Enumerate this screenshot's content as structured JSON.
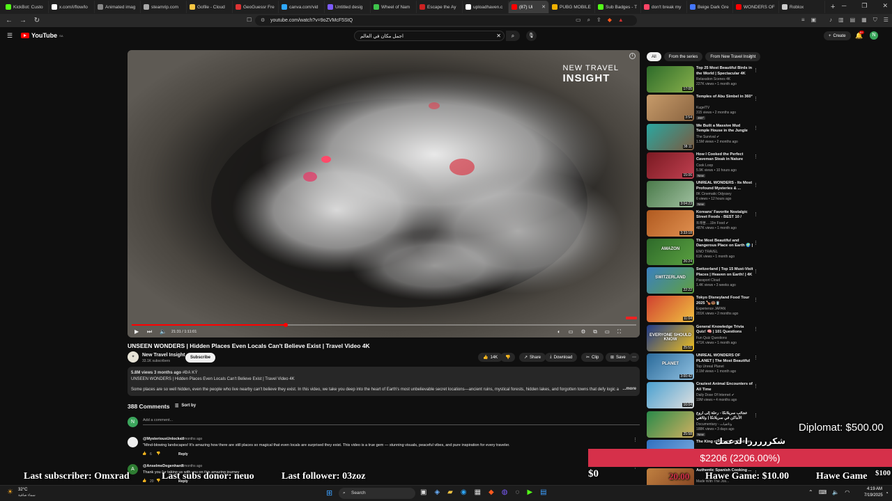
{
  "browser": {
    "tabs": [
      {
        "label": "KickBot: Custo",
        "color": "#53fc18"
      },
      {
        "label": "x.com/i/flow/lo",
        "color": "#ffffff"
      },
      {
        "label": "Animated imag",
        "color": "#888888"
      },
      {
        "label": "steamrip.com",
        "color": "#aaaaaa"
      },
      {
        "label": "Gofile - Cloud",
        "color": "#f5c542"
      },
      {
        "label": "GeoGuessr Fre",
        "color": "#d33"
      },
      {
        "label": "canva.com/vid",
        "color": "#2ea8ff"
      },
      {
        "label": "Untitled desig",
        "color": "#7d5cff"
      },
      {
        "label": "Wheel of Nam",
        "color": "#3ec44b"
      },
      {
        "label": "Escape the Ay",
        "color": "#cc2222"
      },
      {
        "label": "uploadhaven.c",
        "color": "#ffffff"
      },
      {
        "label": "(87) Ui",
        "color": "#ff0000",
        "active": true
      },
      {
        "label": "PUBG MOBILE",
        "color": "#f0b000"
      },
      {
        "label": "Sub Badges - T",
        "color": "#53fc18"
      },
      {
        "label": "don't break my",
        "color": "#ff4466"
      },
      {
        "label": "Beige Dark Gre",
        "color": "#4477ff"
      },
      {
        "label": "WONDERS OF",
        "color": "#ff0000"
      },
      {
        "label": "Roblox",
        "color": "#cccccc"
      }
    ],
    "new_tab_label": "+",
    "url": "youtube.com/watch?v=9oZVMcF5StQ"
  },
  "youtube": {
    "logo_text": "YouTube",
    "logo_sup": "SA",
    "search_value": "اجمل مكان في العالم",
    "create_label": "Create",
    "notif_count": "9+",
    "avatar_letter": "N",
    "player": {
      "watermark_top": "NEW TRAVEL",
      "watermark_bottom": "INSIGHT",
      "time": "21:31 / 1:11:01",
      "progress": 0.305
    },
    "video_title": "UNSEEN WONDERS | Hidden Places Even Locals Can't Believe Exist | Travel Video 4K",
    "channel": {
      "name": "New Travel Insight",
      "subs": "33.1K subscribers",
      "subscribe_label": "Subscribe"
    },
    "actions": {
      "likes": "14K",
      "share": "Share",
      "download": "Download",
      "clip": "Clip",
      "save": "Save"
    },
    "description": {
      "meta": "5.8M views  3 months ago  ",
      "meta_tag": "#ĐA KỲ",
      "line1": "UNSEEN WONDERS | Hidden Places Even Locals Can't Believe Exist | Travel Video 4K",
      "body": "Some places are so well hidden, even the people who live nearby can't believe they exist. In this video, we take you deep into the heart of Earth's most unbelievable secret locations—ancient ruins, mystical forests, hidden lakes, and forgotten towns that defy logic and time. These unseen",
      "more": "...more"
    },
    "comments": {
      "count_label": "388 Comments",
      "sort_label": "Sort by",
      "add_placeholder": "Add a comment...",
      "user_letter": "N",
      "items": [
        {
          "author": "@MysteriousUnlocked",
          "when": "2 months ago",
          "text": "\"Mind-blowing landscapes! It's amazing how there are still places so magical that even locals are surprised they exist. This video is a true gem — stunning visuals, peaceful vibes, and pure inspiration for every traveler.",
          "likes": "6",
          "reply": "Reply",
          "avatar_letter": "",
          "avatar_color": "#eeeeee"
        },
        {
          "author": "@AnselmeDegenhardt",
          "when": "2 months ago",
          "text": "Thank you for taking us with you on this amazing journey",
          "likes": "20",
          "reply": "Reply",
          "avatar_letter": "A",
          "avatar_color": "#2e7d32"
        }
      ]
    },
    "chips": [
      "All",
      "From the series",
      "From New Travel Insight"
    ],
    "recommendations": [
      {
        "title": "Top 25 Most Beautiful Birds in the World | Spectacular 4K Bir...",
        "channel": "Relaxation Scenes 4K",
        "meta": "227K views • 1 month ago",
        "duration": "17:05",
        "colors": [
          "#2d6b2a",
          "#88b04b"
        ]
      },
      {
        "title": "Temples of Abu Simbel in 360°",
        "channel": "KugelTV",
        "meta": "315 views • 2 months ago",
        "badge": "360°",
        "duration": "3:54",
        "colors": [
          "#c79b6a",
          "#8a6440"
        ]
      },
      {
        "title": "We Built a Massive Mud Temple House in the Jungle With Pools",
        "channel": "The Survival ✔",
        "meta": "1.5M views • 2 months ago",
        "duration": "38:11",
        "colors": [
          "#2aa7a0",
          "#7a5a40"
        ]
      },
      {
        "title": "How I Cooked the Perfect Caveman Steak in Nature",
        "channel": "Cook Loop",
        "meta": "5.9K views • 10 hours ago",
        "badge": "New",
        "duration": "15:06",
        "colors": [
          "#7a1a22",
          "#c04050"
        ]
      },
      {
        "title": "UNREAL WONDERS - Its Most Profound Mysteries & ...",
        "channel": "8K Cinematic Odyssey",
        "meta": "6 views • 12 hours ago",
        "badge": "New",
        "duration": "3:04:23",
        "colors": [
          "#4a7a4a",
          "#a0c0a0"
        ]
      },
      {
        "title": "Koreans' Favorite Nostalgic Street Foods - BEST 10 / Kore...",
        "channel": "트래블... JJin Food ✔",
        "meta": "487K views • 1 month ago",
        "duration": "3:33:18",
        "colors": [
          "#b05a20",
          "#e09050"
        ]
      },
      {
        "title": "The Most Beautiful and Dangerous Place on Earth 🌍 | ...",
        "channel": "ENO TRAVEL",
        "meta": "61K views • 1 month ago",
        "thumb_text": "AMAZON",
        "duration": "26:24",
        "colors": [
          "#2e6a2a",
          "#5aa040"
        ]
      },
      {
        "title": "Switzerland | Top 15 Must-Visit Places | Heaven on Earth! | 4K",
        "channel": "Passport Cloud",
        "meta": "1.4K views • 3 weeks ago",
        "thumb_text": "SWITZERLAND",
        "duration": "22:22",
        "colors": [
          "#3a80c0",
          "#60a040"
        ]
      },
      {
        "title": "Tokyo Disneyland Food Tour 2025 🍗🍩🥤",
        "channel": "Experience JAPAN",
        "meta": "201K views • 2 months ago",
        "duration": "11:04",
        "colors": [
          "#d04030",
          "#f0c040"
        ]
      },
      {
        "title": "General Knowledge Trivia Quiz! 🧠 | 101 Questions EVERYON...",
        "channel": "Fun Quiz Questions",
        "meta": "471K views • 1 month ago",
        "thumb_text": "EVERYONE SHOULD KNOW",
        "duration": "25:51",
        "colors": [
          "#1e3a8a",
          "#f0c020"
        ]
      },
      {
        "title": "UNREAL WONDERS OF PLANET | The Most Beautiful Places to ...",
        "channel": "Top Unreal Planet",
        "meta": "2.1M views • 1 month ago",
        "thumb_text": "PLANET",
        "duration": "3:00:42",
        "colors": [
          "#2a6a9a",
          "#90c0e0"
        ]
      },
      {
        "title": "Craziest Animal Encounters of All Time",
        "channel": "Daily Dose Of Internet ✔",
        "meta": "19M views • 4 months ago",
        "duration": "16:04",
        "colors": [
          "#4aa0d0",
          "#e0e0e0"
        ]
      },
      {
        "title": "عجائب سريلانكا - رحلة إلى أروع الأماكن في سريلانكا | وثائقي",
        "channel": "Documentary - وثائقيات",
        "meta": "188K views • 3 days ago",
        "badge": "New",
        "duration": "25:58",
        "colors": [
          "#2a8a4a",
          "#d0b060"
        ]
      },
      {
        "title": "The King of American Badges",
        "channel": "",
        "meta": "",
        "duration": "",
        "colors": [
          "#3070c0",
          "#80b0e0"
        ]
      },
      {
        "title": "Authentic Spanish Cooking ...",
        "channel": "Made With The Jos...",
        "meta": "",
        "duration": "",
        "colors": [
          "#c08040",
          "#804020"
        ]
      }
    ]
  },
  "stream_overlay": {
    "diplomat": "Diplomat: $500.00",
    "arabic": "شكرررررا لدعمك",
    "goal": "$2206 (2206.00%)",
    "goal_value": 2206.0,
    "zero": "$0",
    "hawe_game": "Hawe Game: $10.00",
    "hawe_game2": "Hawe Game",
    "hundred": "$100",
    "twenty": "20.00",
    "last_subscriber": "Last subscriber: Omxrad",
    "last_subs_donor": "Last subs donor: neuo",
    "last_follower": "Last follower: 03zoz"
  },
  "taskbar": {
    "weather_temp": "32°C",
    "weather_desc": "سماء صافية",
    "search_label": "Search",
    "time": "4:19 AM",
    "date": "7/19/2025"
  }
}
